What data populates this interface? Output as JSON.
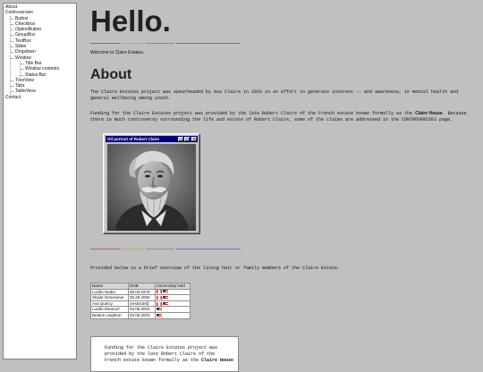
{
  "nav": {
    "items": [
      {
        "label": "About"
      },
      {
        "label": "Controversies",
        "children": [
          {
            "label": "Button"
          },
          {
            "label": "Checkbox"
          },
          {
            "label": "OptionButton"
          },
          {
            "label": "GroupBox"
          },
          {
            "label": "TextBox"
          },
          {
            "label": "Slider"
          },
          {
            "label": "Dropdown"
          },
          {
            "label": "Window",
            "children": [
              {
                "label": "Title Bar"
              },
              {
                "label": "Window contents"
              },
              {
                "label": "Status Bar"
              }
            ]
          },
          {
            "label": "TreeView"
          },
          {
            "label": "Tabs"
          },
          {
            "label": "TableView"
          }
        ]
      },
      {
        "label": "Contact"
      }
    ]
  },
  "header": {
    "title": "Hello.",
    "welcome": "Welcome to Claire Estates."
  },
  "about": {
    "heading": "About",
    "paragraph1": "The Claire Estates project was spearheaded by Ava Claire in 2016 in an effort to generate interest -- and awareness, in mental health and general wellbeing among youth.",
    "paragraph2_before": "Funding for the Claire Estates project was provided by the late Robert Claire of the French estate known formally as the ",
    "paragraph2_bold": "Claire House",
    "paragraph2_after": ". Because there is much controversy surrounding the life and estate of Robert Claire, some of the claims are addressed in the CONTROVERSIES page."
  },
  "image_window": {
    "title": "Oil portrait of Robert Claire",
    "buttons": [
      "_",
      "□",
      "×"
    ]
  },
  "heirs": {
    "intro": "Provided below is a brief overview of the living heir or family members of the Claire Estate.",
    "columns": [
      "Name",
      "DOB",
      "Citizenship held"
    ],
    "rows": [
      {
        "name": "Lucille Nadia",
        "dob": "09.03.1978",
        "flags": [
          "ca",
          "us"
        ]
      },
      {
        "name": "Skylar Genevieve",
        "dob": "05.28.2000",
        "flags": [
          "ca",
          "us"
        ]
      },
      {
        "name": "Ava Quincy",
        "dob": "(restricted)",
        "flags": [
          "ca",
          "us"
        ]
      },
      {
        "name": "Lucille Eleanor*",
        "dob": "03.06.2003",
        "flags": [
          "us"
        ]
      },
      {
        "name": "Beatrix Leighton",
        "dob": "03.06.2003",
        "flags": [
          "us"
        ]
      }
    ]
  },
  "bottom_box": {
    "line1": "Funding for the Claire Estates project was",
    "line2": "provided by the late Robert Claire of the",
    "line3_before": "French estate known formally as the ",
    "line3_bold": "Claire House"
  },
  "colors": {
    "background": "#c0c0c0",
    "titlebar": "#000080"
  }
}
